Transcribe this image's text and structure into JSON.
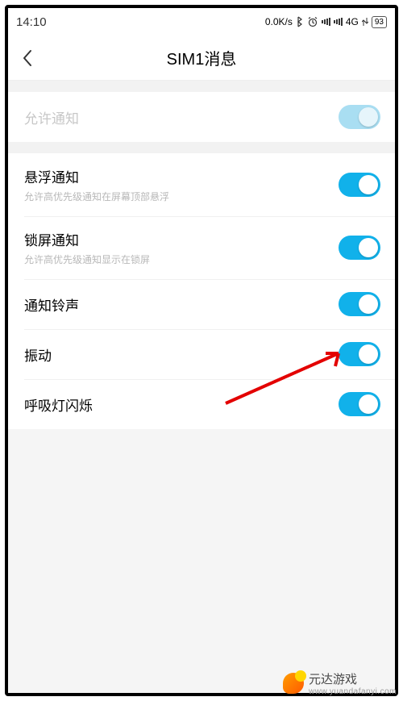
{
  "status": {
    "time": "14:10",
    "net_speed": "0.0K/s",
    "network_label": "4G",
    "battery_percent": "93"
  },
  "header": {
    "title": "SIM1消息"
  },
  "allow_notify": {
    "title": "允许通知",
    "on": true,
    "enabled": false
  },
  "rows": [
    {
      "title": "悬浮通知",
      "sub": "允许高优先级通知在屏幕顶部悬浮",
      "on": true
    },
    {
      "title": "锁屏通知",
      "sub": "允许高优先级通知显示在锁屏",
      "on": true
    },
    {
      "title": "通知铃声",
      "sub": "",
      "on": true
    },
    {
      "title": "振动",
      "sub": "",
      "on": true
    },
    {
      "title": "呼吸灯闪烁",
      "sub": "",
      "on": true
    }
  ],
  "watermark": {
    "name": "元达游戏",
    "url": "www.yuandafanyi.com"
  }
}
